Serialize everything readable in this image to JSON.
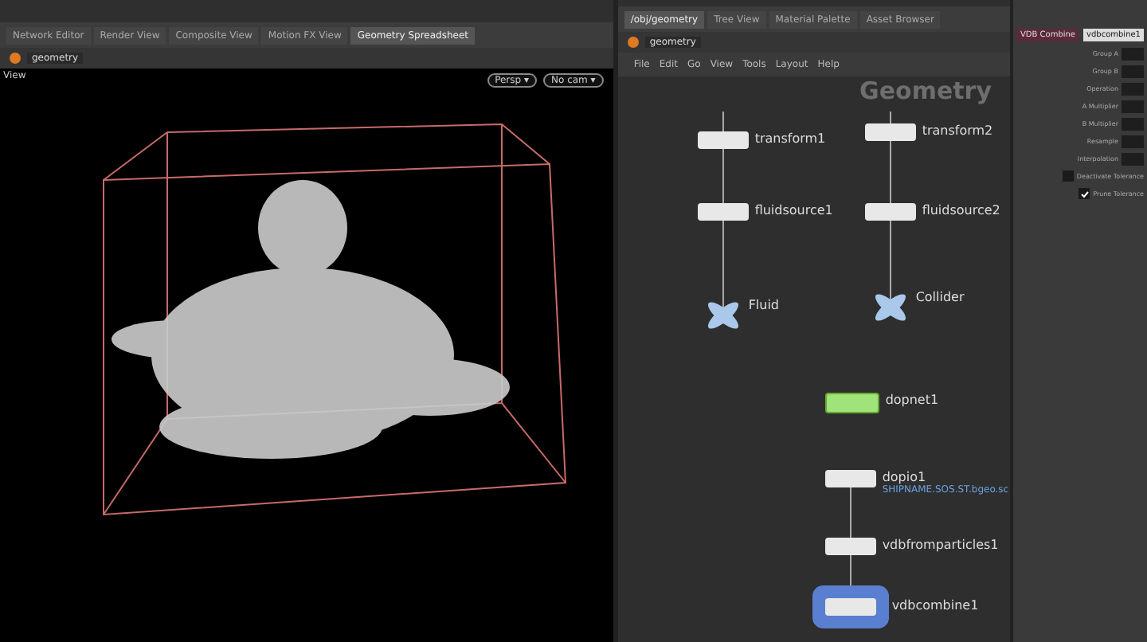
{
  "viewer_tabs": [
    {
      "label": "Network Editor",
      "selected": false
    },
    {
      "label": "Render View",
      "selected": false
    },
    {
      "label": "Composite View",
      "selected": false
    },
    {
      "label": "Motion FX View",
      "selected": false
    },
    {
      "label": "Geometry Spreadsheet",
      "selected": true
    }
  ],
  "viewer_path": "geometry",
  "viewport": {
    "title": "View",
    "camera_menus": [
      "Persp ▾",
      "No cam ▾"
    ]
  },
  "network_tabs": [
    {
      "label": "/obj/geometry",
      "selected": true
    },
    {
      "label": "Tree View",
      "selected": false
    },
    {
      "label": "Material Palette",
      "selected": false
    },
    {
      "label": "Asset Browser",
      "selected": false
    }
  ],
  "network_path": "geometry",
  "network_menu": [
    "File",
    "Edit",
    "Go",
    "View",
    "Tools",
    "Layout",
    "Help"
  ],
  "network_context": "Geometry",
  "nodes": [
    {
      "name": "transform1",
      "kind": "sop"
    },
    {
      "name": "transform2",
      "kind": "sop"
    },
    {
      "name": "fluidsource1",
      "kind": "sop"
    },
    {
      "name": "fluidsource2",
      "kind": "sop"
    },
    {
      "name": "Fluid",
      "kind": "null"
    },
    {
      "name": "Collider",
      "kind": "null"
    },
    {
      "name": "dopnet1",
      "kind": "dop"
    },
    {
      "name": "dopio1",
      "kind": "sop",
      "note": "SHIPNAME.SOS.ST.bgeo.sc"
    },
    {
      "name": "vdbfromparticles1",
      "kind": "sop"
    },
    {
      "name": "vdbcombine1",
      "kind": "display"
    }
  ],
  "params": {
    "node_type": "VDB Combine",
    "node_name": "vdbcombine1",
    "rows": [
      {
        "label": "Group A",
        "kind": "field"
      },
      {
        "label": "Group B",
        "kind": "field"
      },
      {
        "label": "Operation",
        "kind": "field"
      },
      {
        "label": "A Multiplier",
        "kind": "field"
      },
      {
        "label": "B Multiplier",
        "kind": "field"
      },
      {
        "label": "Resample",
        "kind": "field"
      },
      {
        "label": "Interpolation",
        "kind": "field"
      },
      {
        "label": "Deactivate Tolerance",
        "kind": "check",
        "checked": false
      },
      {
        "label": "Prune Tolerance",
        "kind": "check",
        "checked": true
      }
    ]
  }
}
